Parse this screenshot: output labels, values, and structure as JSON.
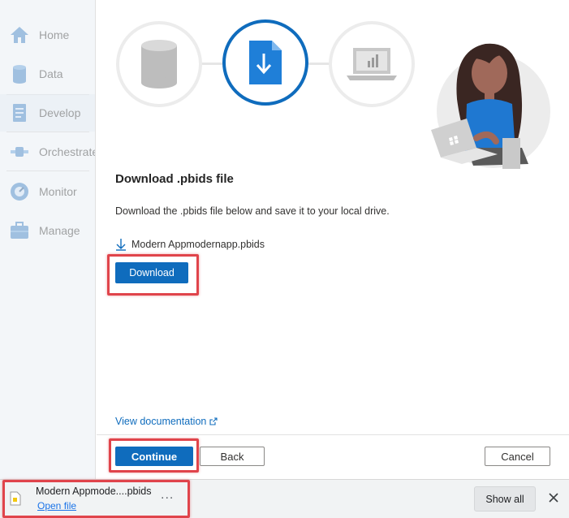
{
  "sidebar": {
    "items": [
      {
        "label": "Home",
        "icon": "home-icon"
      },
      {
        "label": "Data",
        "icon": "database-icon"
      },
      {
        "label": "Develop",
        "icon": "document-icon"
      },
      {
        "label": "Orchestrate",
        "icon": "pipeline-icon"
      },
      {
        "label": "Monitor",
        "icon": "gauge-icon"
      },
      {
        "label": "Manage",
        "icon": "toolbox-icon"
      }
    ],
    "active_item": "Develop"
  },
  "main": {
    "steps": [
      "database-step-icon",
      "download-file-step-icon",
      "laptop-chart-step-icon"
    ],
    "active_step": 2,
    "title": "Download .pbids file",
    "description": "Download the .pbids file below and save it to your local drive.",
    "file_name": "Modern Appmodernapp.pbids",
    "download_label": "Download",
    "doc_link": "View documentation",
    "continue_label": "Continue",
    "back_label": "Back",
    "cancel_label": "Cancel"
  },
  "download_bar": {
    "file_name": "Modern Appmode....pbids",
    "open_label": "Open file",
    "more_label": "...",
    "show_all_label": "Show all"
  },
  "colors": {
    "primary": "#0f6cbd",
    "highlight": "#e0444b",
    "sidebar_bg": "#f3f6f9"
  }
}
